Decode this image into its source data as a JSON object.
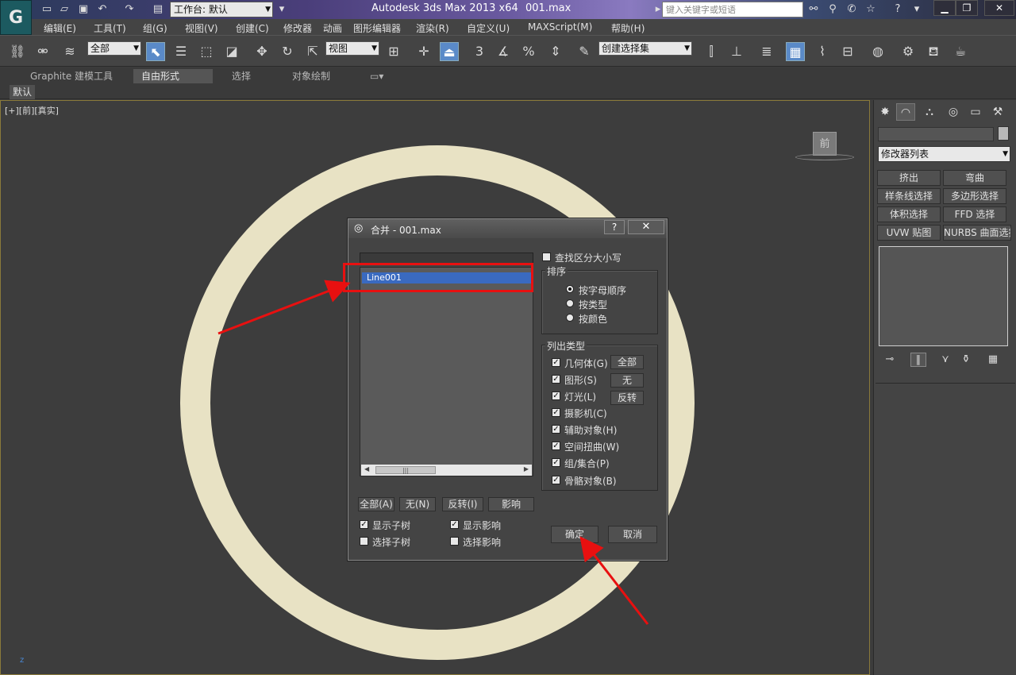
{
  "titlebar": {
    "workspace_label": "工作台: 默认",
    "app_title": "Autodesk 3ds Max  2013 x64",
    "file_name": "001.max",
    "search_placeholder": "键入关键字或短语"
  },
  "menu": {
    "items": [
      "编辑(E)",
      "工具(T)",
      "组(G)",
      "视图(V)",
      "创建(C)",
      "修改器",
      "动画",
      "图形编辑器",
      "渲染(R)",
      "自定义(U)",
      "MAXScript(M)",
      "帮助(H)"
    ]
  },
  "toolbar": {
    "selection_filter": "全部",
    "reference_coord": "视图",
    "named_selection": "创建选择集",
    "snap_number": "3",
    "percent_snap": "%"
  },
  "ribbon": {
    "tabs": [
      "Graphite 建模工具",
      "自由形式",
      "选择",
      "对象绘制"
    ],
    "active_tab": "自由形式",
    "sub_label": "默认"
  },
  "viewport": {
    "label": "[+][前][真实]",
    "viewcube_face": "前",
    "axis": "z",
    "ring_color": "#e8e2c4"
  },
  "command_panel": {
    "modifier_list": "修改器列表",
    "buttons": [
      "挤出",
      "弯曲",
      "样条线选择",
      "多边形选择",
      "体积选择",
      "FFD 选择",
      "UVW 贴图",
      "NURBS 曲面选择"
    ]
  },
  "dialog": {
    "title": "合并 - 001.max",
    "help": "?",
    "close": "✕",
    "list_items": [
      "Line001"
    ],
    "case_sensitive_label": "查找区分大小写",
    "sort": {
      "title": "排序",
      "options": [
        "按字母顺序",
        "按类型",
        "按颜色"
      ],
      "selected": "按字母顺序"
    },
    "list_types": {
      "title": "列出类型",
      "items": [
        "几何体(G)",
        "图形(S)",
        "灯光(L)",
        "摄影机(C)",
        "辅助对象(H)",
        "空间扭曲(W)",
        "组/集合(P)",
        "骨骼对象(B)"
      ],
      "buttons": [
        "全部",
        "无",
        "反转"
      ]
    },
    "list_buttons": [
      "全部(A)",
      "无(N)",
      "反转(I)",
      "影响"
    ],
    "checks": {
      "show_subtree": "显示子树",
      "select_subtree": "选择子树",
      "show_influence": "显示影响",
      "select_influence": "选择影响"
    },
    "ok": "确定",
    "cancel": "取消"
  },
  "colors": {
    "annotation_red": "#e81010",
    "selection_blue": "#3a6ac0"
  }
}
